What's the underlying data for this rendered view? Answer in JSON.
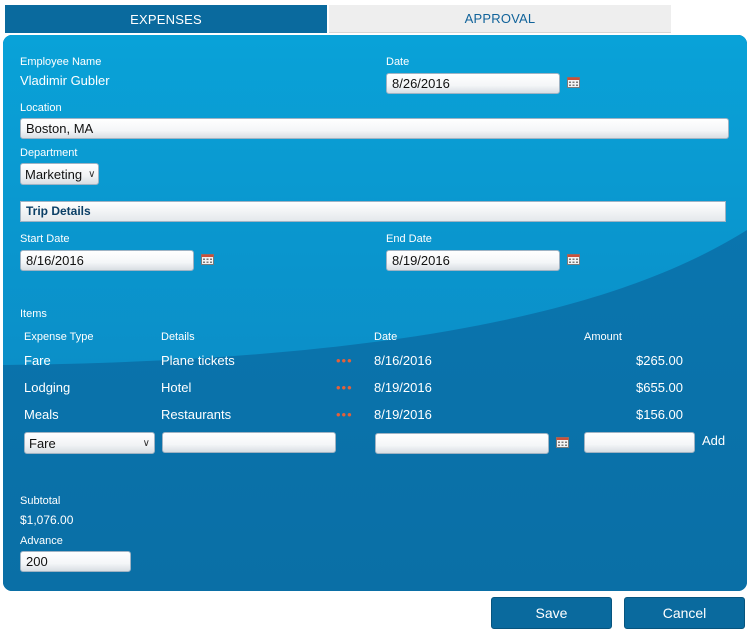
{
  "tabs": {
    "expenses": "EXPENSES",
    "approval": "APPROVAL"
  },
  "form": {
    "employee_name_label": "Employee Name",
    "employee_name": "Vladimir Gubler",
    "date_label": "Date",
    "date_value": "8/26/2016",
    "location_label": "Location",
    "location_value": "Boston, MA",
    "department_label": "Department",
    "department_value": "Marketing"
  },
  "trip": {
    "section_title": "Trip Details",
    "start_label": "Start Date",
    "start_value": "8/16/2016",
    "end_label": "End Date",
    "end_value": "8/19/2016"
  },
  "items": {
    "label": "Items",
    "columns": [
      "Expense Type",
      "Details",
      "Date",
      "Amount"
    ],
    "rows": [
      {
        "type": "Fare",
        "details": "Plane tickets",
        "date": "8/16/2016",
        "amount": "$265.00"
      },
      {
        "type": "Lodging",
        "details": "Hotel",
        "date": "8/19/2016",
        "amount": "$655.00"
      },
      {
        "type": "Meals",
        "details": "Restaurants",
        "date": "8/19/2016",
        "amount": "$156.00"
      }
    ],
    "ellipsis": "•••",
    "new_type_value": "Fare",
    "add_label": "Add"
  },
  "totals": {
    "subtotal_label": "Subtotal",
    "subtotal_value": "$1,076.00",
    "advance_label": "Advance",
    "advance_value": "200"
  },
  "buttons": {
    "save": "Save",
    "cancel": "Cancel"
  },
  "colors": {
    "accent": "#0a6a9e",
    "panel_light": "#0a9ad2",
    "panel_dark": "#0a6a9e",
    "ellipsis": "#e4603a"
  },
  "icons": {
    "calendar": "calendar-icon",
    "dropdown": "chevron-down-icon"
  }
}
